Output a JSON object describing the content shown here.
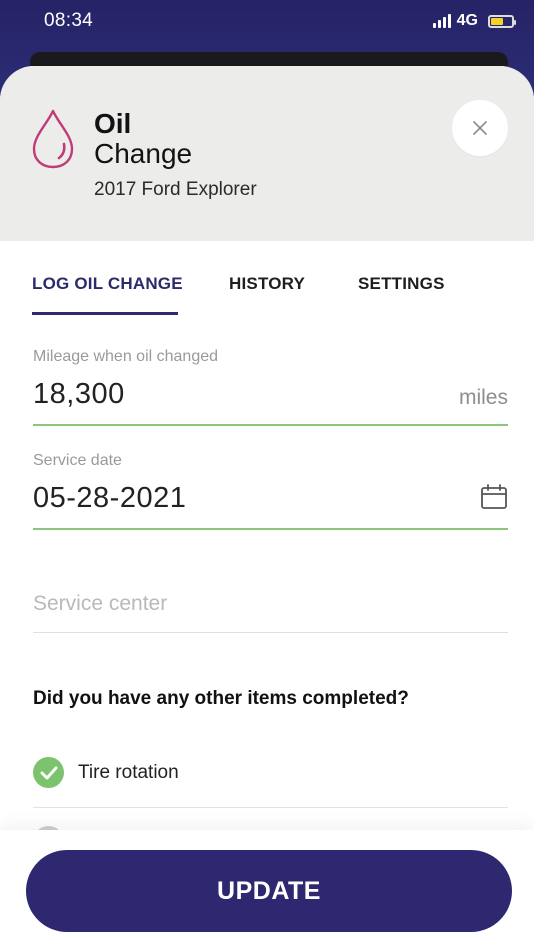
{
  "status_bar": {
    "time": "08:34",
    "network": "4G"
  },
  "header": {
    "title_line1": "Oil",
    "title_line2": "Change",
    "vehicle": "2017 Ford Explorer",
    "icon": "oil-drop-icon",
    "close_icon": "close-icon"
  },
  "tabs": [
    {
      "label": "LOG OIL CHANGE",
      "active": true
    },
    {
      "label": "HISTORY",
      "active": false
    },
    {
      "label": "SETTINGS",
      "active": false
    }
  ],
  "form": {
    "mileage": {
      "label": "Mileage when oil changed",
      "value": "18,300",
      "unit": "miles"
    },
    "service_date": {
      "label": "Service date",
      "value": "05-28-2021",
      "icon": "calendar-icon"
    },
    "service_center": {
      "placeholder": "Service center"
    }
  },
  "completed_items": {
    "question": "Did you have any other items completed?",
    "items": [
      {
        "label": "Tire rotation",
        "checked": true
      }
    ]
  },
  "actions": {
    "update_label": "UPDATE"
  },
  "colors": {
    "brand": "#2d2870",
    "accent_green": "#7cc36e",
    "drop_icon": "#c23a78"
  }
}
